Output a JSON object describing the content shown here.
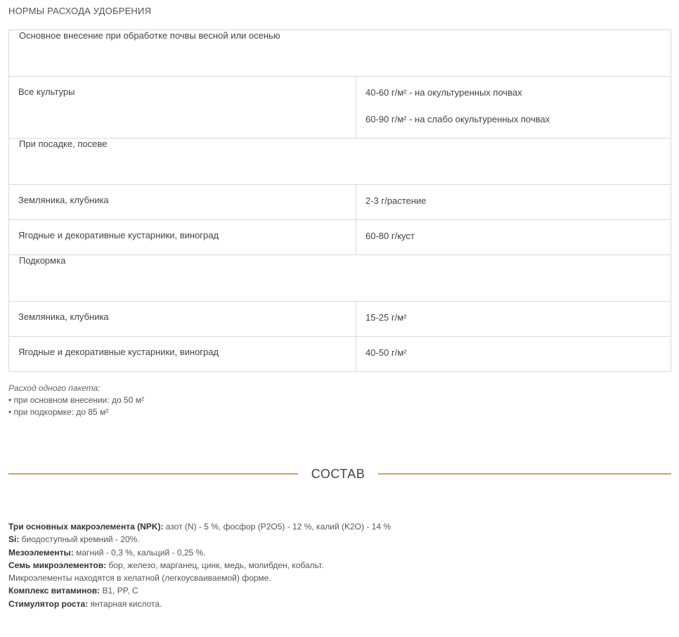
{
  "section_title": "НОРМЫ РАСХОДА УДОБРЕНИЯ",
  "table": {
    "groups": [
      {
        "title": "Основное внесение при обработке почвы весной или осенью",
        "rows": [
          {
            "crop": "Все культуры",
            "rates": [
              "40-60 г/м² - на окультуренных почвах",
              "60-90 г/м² - на слабо окультуренных почвах"
            ]
          }
        ]
      },
      {
        "title": "При посадке, посеве",
        "rows": [
          {
            "crop": "Земляника, клубника",
            "rates": [
              "2-3 г/растение"
            ]
          },
          {
            "crop": "Ягодные и декоративные кустарники, виноград",
            "rates": [
              "60-80 г/куст"
            ]
          }
        ]
      },
      {
        "title": "Подкормка",
        "rows": [
          {
            "crop": "Земляника, клубника",
            "rates": [
              "15-25 г/м²"
            ]
          },
          {
            "crop": "Ягодные и декоративные кустарники, виноград",
            "rates": [
              "40-50 г/м²"
            ]
          }
        ]
      }
    ]
  },
  "note": {
    "heading": "Расход одного пакета:",
    "lines": [
      "• при основном внесении: до 50 м²",
      "• при подкормке: до 85 м²"
    ]
  },
  "composition": {
    "title": "СОСТАВ",
    "items": [
      {
        "label": "Три основных макроэлемента (NPK):",
        "text": " азот (N) - 5 %, фосфор (P2O5) - 12 %, калий (K2O) - 14 %"
      },
      {
        "label": "Si:",
        "text": " биодоступный кремний - 20%."
      },
      {
        "label": "Мезоэлементы:",
        "text": " магний - 0,3 %, кальций - 0,25 %."
      },
      {
        "label": "Семь микроэлементов:",
        "text": " бор, железо, марганец, цинк, медь, молибден, кобальт."
      },
      {
        "label": "",
        "text": "Микроэлементы находятся в хелатной (легкоусваиваемой) форме."
      },
      {
        "label": "Комплекс витаминов:",
        "text": " B1, PP, C"
      },
      {
        "label": "Стимулятор роста:",
        "text": " янтарная кислота."
      }
    ]
  },
  "colors": {
    "accent": "#c9a464",
    "border": "#d9d9d9",
    "text": "#444444"
  }
}
